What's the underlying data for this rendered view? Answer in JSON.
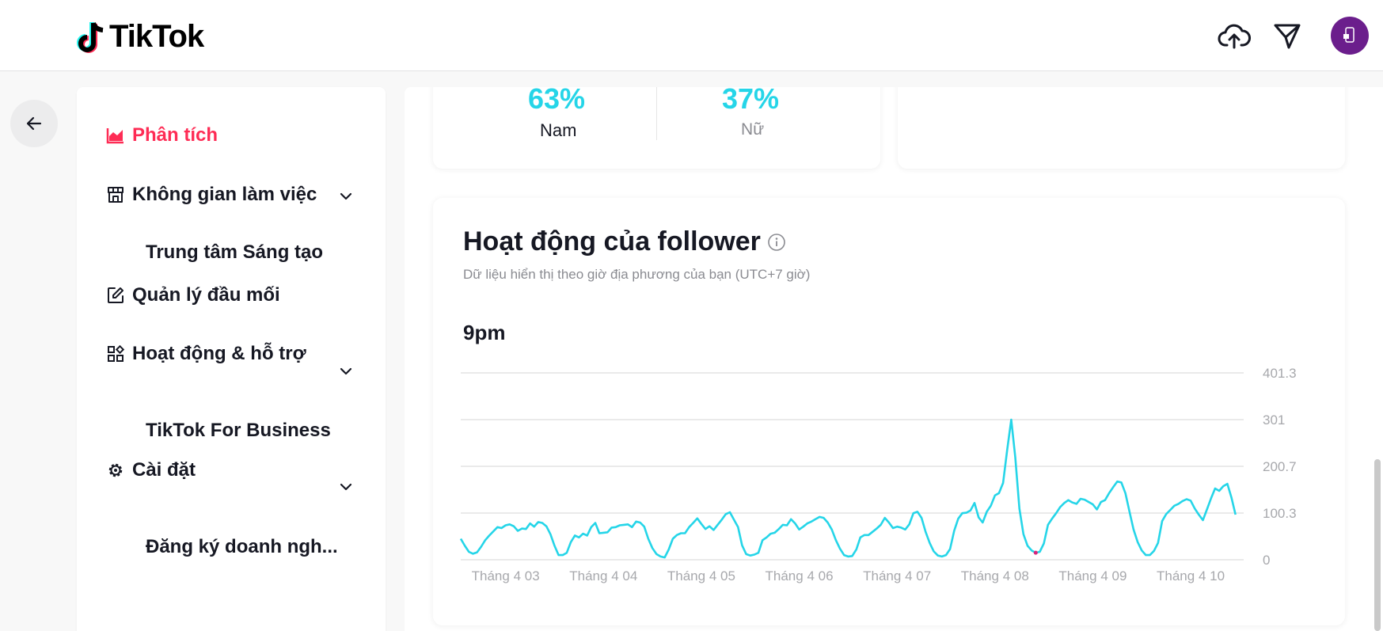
{
  "header": {
    "logo_text": "TikTok",
    "icons": [
      "upload-cloud-icon",
      "send-icon"
    ],
    "avatar_color": "#6b1e8c"
  },
  "sidebar": {
    "items": [
      {
        "label": "Phân tích",
        "icon": "chart-icon",
        "active": true
      },
      {
        "label": "Không gian làm việc",
        "icon": "store-icon",
        "expandable": true
      },
      {
        "label": "Trung tâm Sáng tạo",
        "sub": true
      },
      {
        "label": "Quản lý đầu mối",
        "icon": "edit-icon"
      },
      {
        "label": "Hoạt động & hỗ trợ",
        "icon": "apps-icon",
        "expandable": true
      },
      {
        "label": "TikTok For Business",
        "sub": true
      },
      {
        "label": "Cài đặt",
        "icon": "gear-icon",
        "expandable": true
      },
      {
        "label": "Đăng ký doanh ngh...",
        "sub": true
      }
    ]
  },
  "gender": {
    "male_pct": "63%",
    "male_label": "Nam",
    "female_pct": "37%",
    "female_label": "Nữ"
  },
  "follower_activity": {
    "title": "Hoạt động của follower",
    "subtitle": "Dữ liệu hiển thị theo giờ địa phương của bạn (UTC+7 giờ)",
    "peak_time": "9pm"
  },
  "colors": {
    "accent": "#fe2c55",
    "line": "#25d5e8",
    "marker": "#d6247a"
  },
  "chart_data": {
    "type": "line",
    "title": "",
    "xlabel": "",
    "ylabel": "",
    "ylim": [
      0,
      401.3
    ],
    "y_ticks": [
      "0",
      "100.3",
      "200.7",
      "301",
      "401.3"
    ],
    "x_ticks": [
      "Tháng 4 03",
      "Tháng 4 04",
      "Tháng 4 05",
      "Tháng 4 06",
      "Tháng 4 07",
      "Tháng 4 08",
      "Tháng 4 09",
      "Tháng 4 10"
    ],
    "x_domain": [
      0,
      192
    ],
    "x_tick_positions": [
      11,
      35,
      59,
      83,
      107,
      131,
      155,
      179
    ],
    "grid": true,
    "marker_index": 141,
    "series": [
      {
        "values": [
          45,
          30,
          17,
          13,
          16,
          28,
          42,
          52,
          61,
          70,
          68,
          74,
          76,
          72,
          62,
          67,
          66,
          78,
          71,
          81,
          79,
          72,
          55,
          30,
          10,
          10,
          15,
          38,
          52,
          48,
          56,
          52,
          70,
          79,
          57,
          58,
          59,
          69,
          70,
          74,
          75,
          76,
          70,
          82,
          80,
          71,
          45,
          25,
          12,
          7,
          5,
          22,
          45,
          53,
          57,
          57,
          70,
          79,
          89,
          77,
          66,
          72,
          64,
          75,
          86,
          98,
          102,
          86,
          70,
          31,
          12,
          9,
          11,
          15,
          42,
          48,
          56,
          58,
          66,
          75,
          74,
          87,
          78,
          65,
          71,
          78,
          82,
          87,
          92,
          90,
          80,
          65,
          42,
          24,
          10,
          7,
          8,
          22,
          48,
          53,
          53,
          60,
          67,
          75,
          90,
          80,
          68,
          71,
          69,
          65,
          76,
          100,
          103,
          90,
          60,
          36,
          18,
          9,
          7,
          10,
          23,
          62,
          88,
          100,
          101,
          106,
          122,
          91,
          80,
          103,
          116,
          138,
          143,
          165,
          235,
          301,
          220,
          110,
          55,
          30,
          20,
          15,
          17,
          35,
          75,
          88,
          100,
          113,
          122,
          128,
          123,
          120,
          131,
          129,
          124,
          119,
          108,
          124,
          128,
          143,
          156,
          168,
          166,
          143,
          103,
          65,
          38,
          20,
          10,
          10,
          19,
          36,
          83,
          98,
          107,
          116,
          120,
          126,
          130,
          127,
          110,
          97,
          85,
          108,
          132,
          153,
          148,
          158,
          163,
          134,
          97
        ]
      }
    ]
  }
}
